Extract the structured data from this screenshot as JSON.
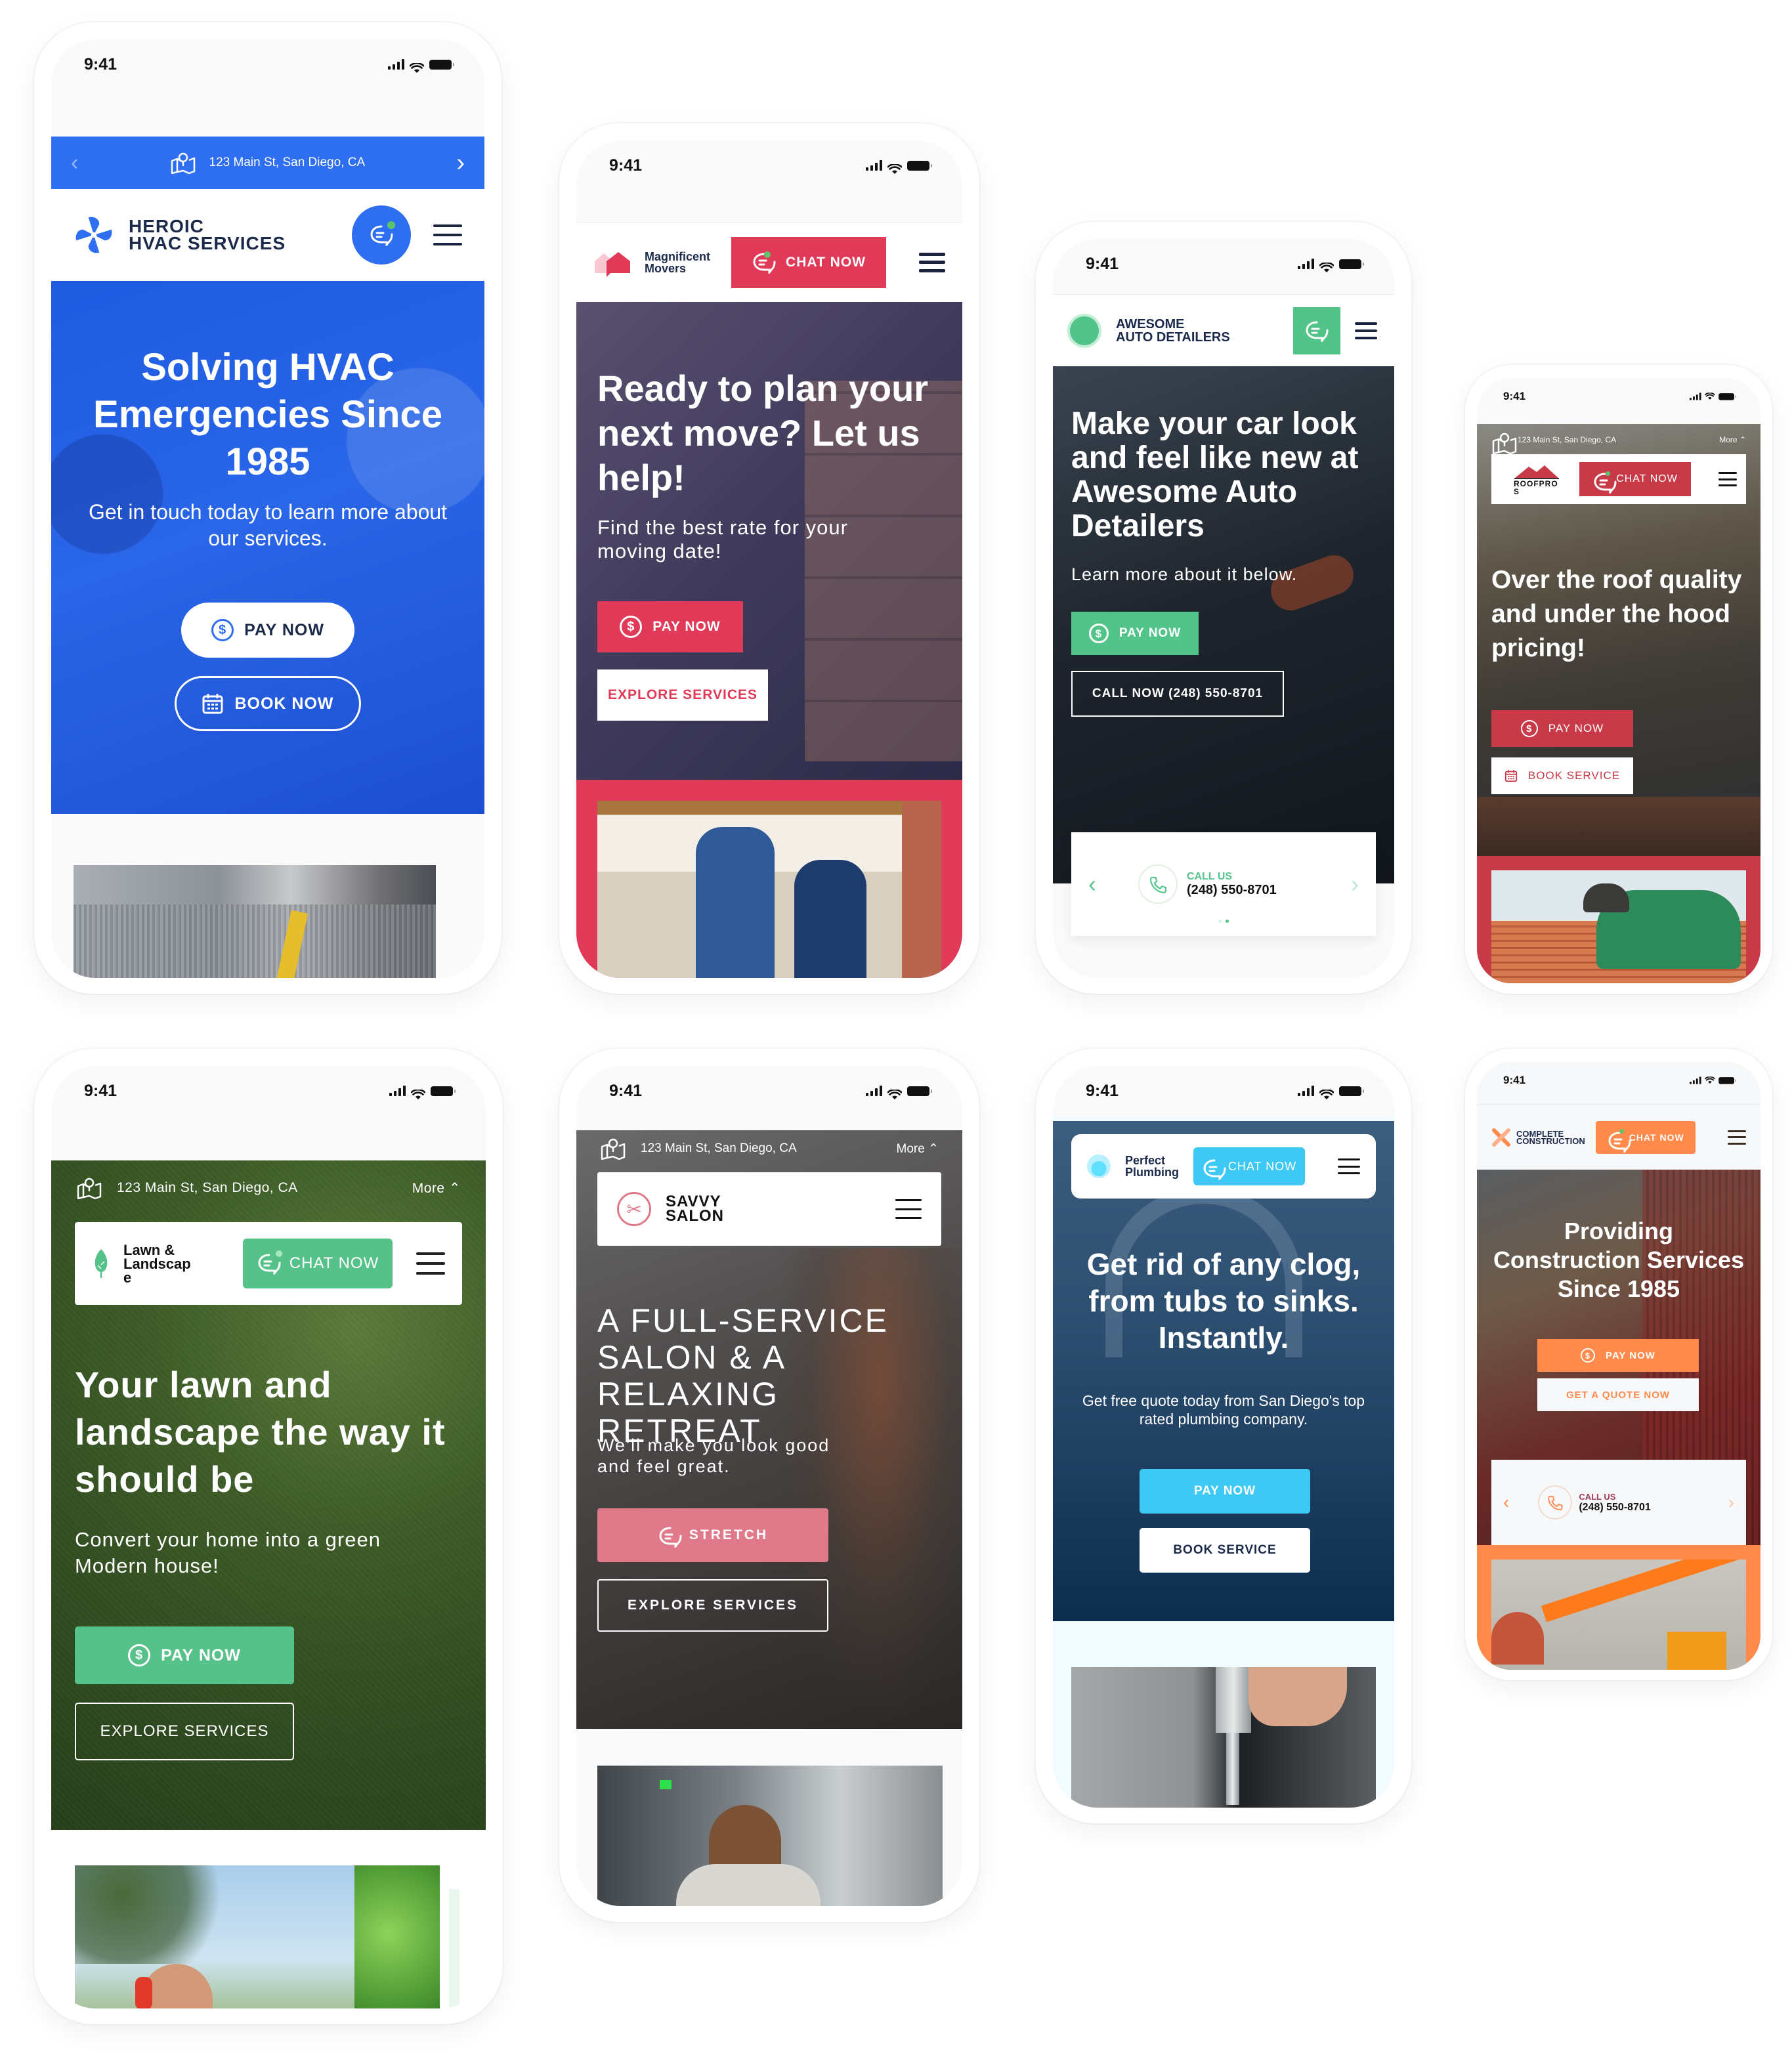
{
  "status_time": "9:41",
  "colors": {
    "hvac_blue": "#2e6ef0",
    "hvac_navy": "#1b2a4a",
    "movers_red": "#e03a58",
    "auto_green": "#52c48a",
    "roof_red": "#c83a47",
    "lawn_green": "#56c28a",
    "salon_pink": "#e07a8a",
    "plumbing_cyan": "#3ec8f4",
    "plumbing_navy": "#0c2d4e",
    "construction_orange": "#ff8a4c"
  },
  "phones": [
    {
      "id": "hvac",
      "address": "123 Main St, San Diego, CA",
      "logo_line1": "HEROIC",
      "logo_line2": "HVAC SERVICES",
      "headline": "Solving HVAC Emergencies Since 1985",
      "subheadline": "Get in touch today to learn more about our services.",
      "primary_button": "PAY NOW",
      "secondary_button": "BOOK NOW",
      "icons": [
        "chevron-left-icon",
        "map-pin-icon",
        "chevron-right-icon",
        "fan-logo-icon",
        "chat-icon",
        "menu-icon",
        "dollar-icon",
        "calendar-icon"
      ]
    },
    {
      "id": "movers",
      "logo_line1": "Magnificent",
      "logo_line2": "Movers",
      "chat_button": "CHAT NOW",
      "headline": "Ready to plan your next move? Let us help!",
      "subheadline": "Find the best rate for your moving date!",
      "primary_button": "PAY NOW",
      "secondary_button": "EXPLORE SERVICES"
    },
    {
      "id": "auto",
      "logo_line1": "AWESOME",
      "logo_line2": "AUTO DETAILERS",
      "headline": "Make your car look and feel like new at Awesome Auto Detailers",
      "subheadline": "Learn more about it below.",
      "primary_button": "PAY NOW",
      "secondary_button": "CALL NOW (248) 550-8701",
      "call_label": "CALL US",
      "call_number": "(248) 550-8701",
      "carousel_total": 2,
      "carousel_active": 2
    },
    {
      "id": "roof",
      "address": "123 Main St, San Diego, CA",
      "more_label": "More",
      "logo_text": "ROOFPRO S",
      "chat_button": "CHAT NOW",
      "headline": "Over the roof quality and under the hood pricing!",
      "primary_button": "PAY NOW",
      "secondary_button": "BOOK SERVICE"
    },
    {
      "id": "lawn",
      "address": "123 Main St, San Diego, CA",
      "more_label": "More",
      "logo_line1": "Lawn &",
      "logo_line2": "Landscap",
      "logo_line3": "e",
      "chat_button": "CHAT NOW",
      "headline": "Your lawn and landscape the way it should be",
      "subheadline": "Convert your home into a green Modern house!",
      "primary_button": "PAY NOW",
      "secondary_button": "EXPLORE SERVICES"
    },
    {
      "id": "salon",
      "address": "123 Main St, San Diego, CA",
      "more_label": "More",
      "logo_line1": "SAVVY",
      "logo_line2": "SALON",
      "headline": "A FULL-SERVICE SALON & A RELAXING RETREAT",
      "subheadline": "We'll make you look good and feel great.",
      "primary_button": "STRETCH",
      "secondary_button": "EXPLORE SERVICES"
    },
    {
      "id": "plumbing",
      "logo_line1": "Perfect",
      "logo_line2": "Plumbing",
      "chat_button": "CHAT NOW",
      "headline": "Get rid of any clog, from tubs to sinks. Instantly.",
      "subheadline": "Get free quote today from San Diego's top rated plumbing company.",
      "primary_button": "PAY NOW",
      "secondary_button": "BOOK SERVICE"
    },
    {
      "id": "construction",
      "logo_line1": "COMPLETE",
      "logo_line2": "CONSTRUCTION",
      "chat_button": "CHAT NOW",
      "headline": "Providing Construction Services Since 1985",
      "primary_button": "PAY NOW",
      "secondary_button": "GET A QUOTE NOW",
      "call_label": "CALL US",
      "call_number": "(248) 550-8701"
    }
  ]
}
